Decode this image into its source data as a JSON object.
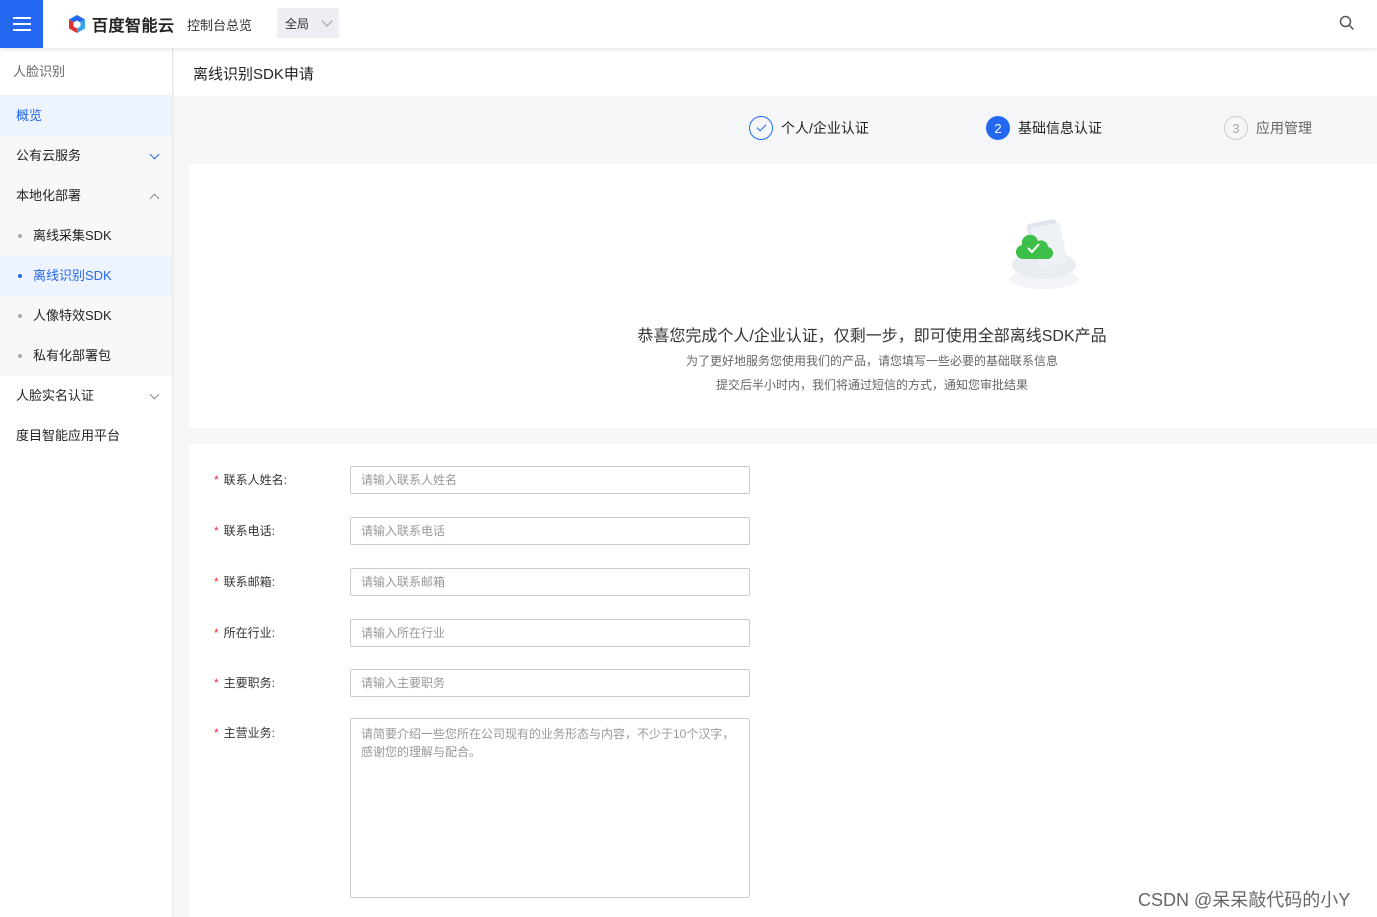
{
  "topbar": {
    "logo_text": "百度智能云",
    "console_link": "控制台总览",
    "scope_value": "全局"
  },
  "sidebar": {
    "title": "人脸识别",
    "items": [
      {
        "label": "概览"
      },
      {
        "label": "公有云服务"
      },
      {
        "label": "本地化部署"
      },
      {
        "label": "人脸实名认证"
      },
      {
        "label": "度目智能应用平台"
      }
    ],
    "sub_items": [
      {
        "label": "离线采集SDK"
      },
      {
        "label": "离线识别SDK"
      },
      {
        "label": "人像特效SDK"
      },
      {
        "label": "私有化部署包"
      }
    ]
  },
  "page": {
    "title": "离线识别SDK申请"
  },
  "steps": [
    {
      "number": "1",
      "label": "个人/企业认证",
      "status": "done"
    },
    {
      "number": "2",
      "label": "基础信息认证",
      "status": "current"
    },
    {
      "number": "3",
      "label": "应用管理",
      "status": "pending"
    }
  ],
  "success": {
    "title": "恭喜您完成个人/企业认证，仅剩一步，即可使用全部离线SDK产品",
    "desc1": "为了更好地服务您使用我们的产品，请您填写一些必要的基础联系信息",
    "desc2": "提交后半小时内，我们将通过短信的方式，通知您审批结果"
  },
  "form": {
    "fields": [
      {
        "label": "联系人姓名:",
        "placeholder": "请输入联系人姓名",
        "value": ""
      },
      {
        "label": "联系电话:",
        "placeholder": "请输入联系电话",
        "value": ""
      },
      {
        "label": "联系邮箱:",
        "placeholder": "请输入联系邮箱",
        "value": ""
      },
      {
        "label": "所在行业:",
        "placeholder": "请输入所在行业",
        "value": ""
      },
      {
        "label": "主要职务:",
        "placeholder": "请输入主要职务",
        "value": ""
      }
    ],
    "textarea": {
      "label": "主营业务:",
      "placeholder": "请简要介绍一些您所在公司现有的业务形态与内容，不少于10个汉字，感谢您的理解与配合。",
      "value": ""
    },
    "required_mark": "*"
  },
  "watermark": "CSDN @呆呆敲代码的小Y",
  "colors": {
    "accent": "#2468f2",
    "required": "#e33333"
  }
}
